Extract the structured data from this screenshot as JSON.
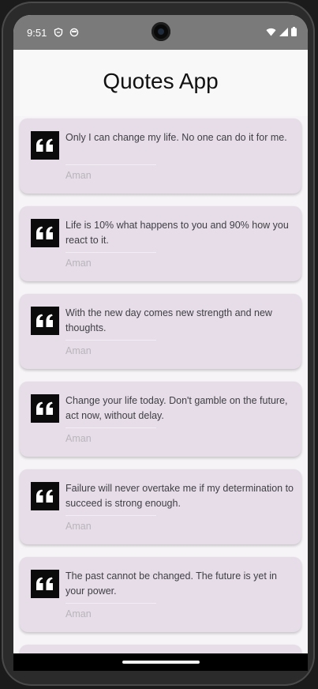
{
  "status_bar": {
    "time": "9:51",
    "left_icons": [
      "shield-icon",
      "sync-icon"
    ],
    "right_icons": [
      "wifi-icon",
      "cellular-icon",
      "battery-icon"
    ]
  },
  "app": {
    "title": "Quotes App"
  },
  "quotes": [
    {
      "text": "Only I can change my life. No one can do it for me.",
      "author": "Aman"
    },
    {
      "text": "Life is 10% what happens to you and 90% how you react to it.",
      "author": "Aman"
    },
    {
      "text": "With the new day comes new strength and new thoughts.",
      "author": "Aman"
    },
    {
      "text": "Change your life today. Don't gamble on the future, act now, without delay.",
      "author": "Aman"
    },
    {
      "text": "Failure will never overtake me if my determination to succeed is strong enough.",
      "author": "Aman"
    },
    {
      "text": "The past cannot be changed. The future is yet in your power.",
      "author": "Aman"
    }
  ],
  "colors": {
    "card_bg": "#e6dde9",
    "quote_icon_bg": "#0b0b0b",
    "status_bar_bg": "#7a7a7a"
  }
}
